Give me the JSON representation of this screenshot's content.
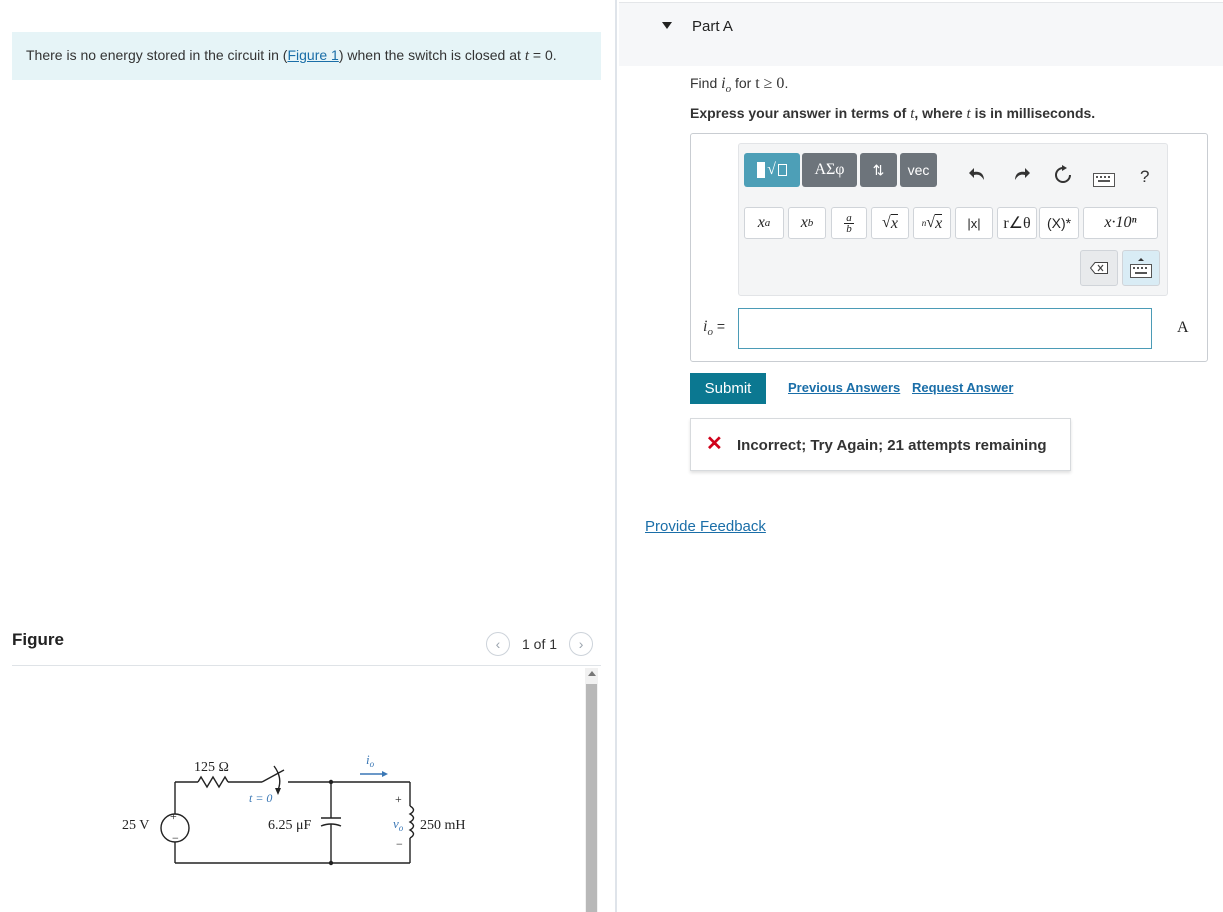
{
  "intro": {
    "text_before": "There is no energy stored in the circuit in (",
    "figure_link": "Figure 1",
    "text_middle": ") when the switch is closed at ",
    "var_t": "t",
    "text_after": " = 0."
  },
  "figure": {
    "title": "Figure",
    "counter": "1 of 1",
    "prev_icon": "chevron-left-icon",
    "next_icon": "chevron-right-icon",
    "circuit": {
      "resistor": "125 Ω",
      "source": "25 V",
      "switch_label": "t = 0",
      "capacitor": "6.25 μF",
      "current": "i",
      "current_sub": "o",
      "voltage": "v",
      "voltage_sub": "o",
      "inductor": "250 mH",
      "plus": "+",
      "minus": "−"
    }
  },
  "part": {
    "title": "Part A",
    "question_find": "Find ",
    "question_var": "i",
    "question_sub": "o",
    "question_for": " for ",
    "question_cond": "t ≥ 0",
    "question_end": ".",
    "instruction_before": "Express your answer in terms of ",
    "instruction_var": "t",
    "instruction_middle": ", where ",
    "instruction_var2": "t",
    "instruction_after": " is in milliseconds."
  },
  "toolbar": {
    "templates_icon": "templates-icon",
    "greek_label": "ΑΣφ",
    "arrows_label": "⇅",
    "vec_label": "vec",
    "undo_icon": "undo-icon",
    "redo_icon": "redo-icon",
    "reset_icon": "reset-icon",
    "keyboard_icon": "keyboard-icon",
    "help_label": "?",
    "superscript_label": "xᵃ",
    "subscript_label": "x_b",
    "fraction_label": "a/b",
    "sqrt_label": "√x",
    "nthroot_label": "ⁿ√x",
    "abs_label": "|x|",
    "polar_label": "r∠θ",
    "conj_label": "(X)*",
    "sci_label": "x·10ⁿ",
    "delete_icon": "backspace-icon",
    "keyboard2_icon": "keyboard-icon"
  },
  "answer": {
    "label_var": "i",
    "label_sub": "o",
    "label_eq": " =",
    "value": "",
    "unit": "A"
  },
  "actions": {
    "submit": "Submit",
    "previous_answers": "Previous Answers",
    "request_answer": "Request Answer"
  },
  "feedback": {
    "status_icon": "x-icon",
    "message": "Incorrect; Try Again; 21 attempts remaining"
  },
  "provide_feedback": "Provide Feedback",
  "colors": {
    "accent": "#0b7891",
    "link": "#1a6ea8",
    "error": "#d0021b",
    "intro_bg": "#e6f4f7"
  }
}
